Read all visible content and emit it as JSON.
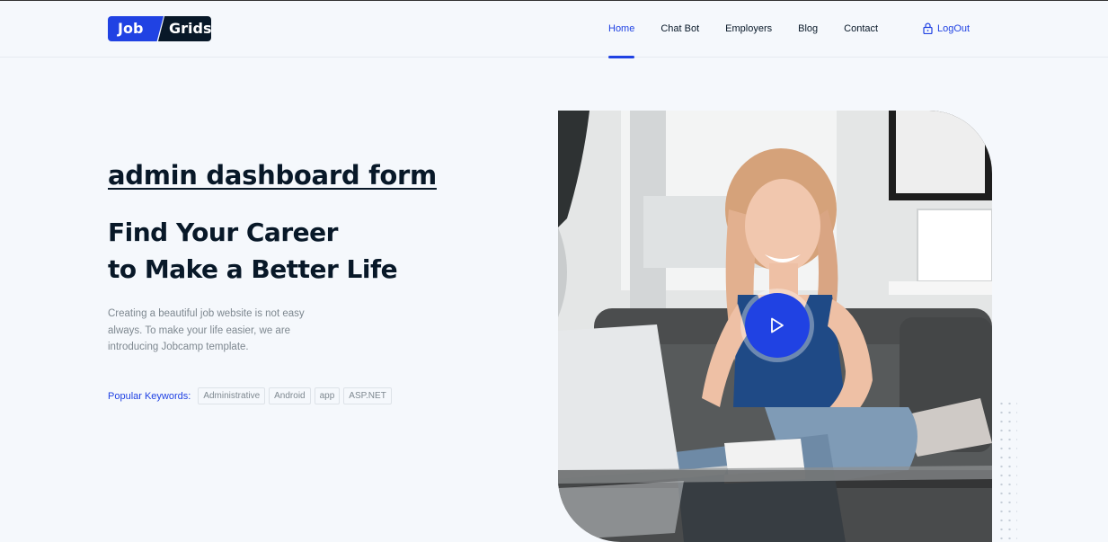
{
  "logo": {
    "part1": "Job",
    "part2": "Grids"
  },
  "nav": {
    "items": [
      {
        "label": "Home",
        "active": true
      },
      {
        "label": "Chat Bot",
        "active": false
      },
      {
        "label": "Employers",
        "active": false
      },
      {
        "label": "Blog",
        "active": false
      },
      {
        "label": "Contact",
        "active": false
      }
    ],
    "logout": "LogOut"
  },
  "hero": {
    "admin_link": "admin dashboard form",
    "title_line1": "Find Your Career",
    "title_line2": "to Make a Better Life",
    "description": "Creating a beautiful job website is not easy always. To make your life easier, we are introducing Jobcamp template.",
    "keywords_label": "Popular Keywords:",
    "keywords": [
      "Administrative",
      "Android",
      "app",
      "ASP.NET"
    ]
  },
  "media": {
    "play_icon": "play-icon",
    "photo": "woman-laptop-photo"
  },
  "colors": {
    "accent": "#2042e3",
    "dark": "#081828",
    "background": "#f5f8fc",
    "muted": "#7e8890"
  }
}
